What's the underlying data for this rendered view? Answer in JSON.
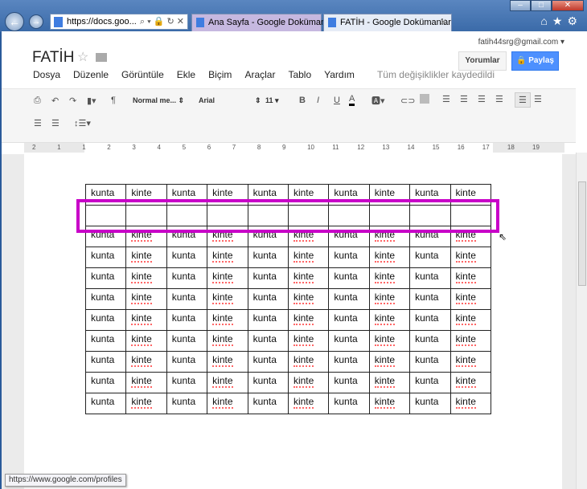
{
  "browser": {
    "address": "https://docs.goo...",
    "tabs": [
      {
        "label": "Ana Sayfa - Google Dokümanlar"
      },
      {
        "label": "FATİH - Google Dokümanlar",
        "active": true
      }
    ],
    "status_url": "https://www.google.com/profiles"
  },
  "header": {
    "title": "FATİH",
    "account": "fatih44srg@gmail.com ▾",
    "comments_label": "Yorumlar",
    "share_label": "Paylaş",
    "share_color": "#4d90fe",
    "save_status": "Tüm değişiklikler kaydedildi"
  },
  "menu": [
    "Dosya",
    "Düzenle",
    "Görüntüle",
    "Ekle",
    "Biçim",
    "Araçlar",
    "Tablo",
    "Yardım"
  ],
  "toolbar": {
    "style": "Normal me...",
    "font": "Arial",
    "size": "11"
  },
  "ruler": [
    "2",
    "1",
    "1",
    "2",
    "3",
    "4",
    "5",
    "6",
    "7",
    "8",
    "9",
    "10",
    "11",
    "12",
    "13",
    "14",
    "15",
    "16",
    "17",
    "18",
    "19"
  ],
  "table": {
    "rows": [
      [
        "kunta",
        "kinte",
        "kunta",
        "kinte",
        "kunta",
        "kinte",
        "kunta",
        "kinte",
        "kunta",
        "kinte"
      ],
      [
        "",
        "",
        "",
        "",
        "",
        "",
        "",
        "",
        "",
        ""
      ],
      [
        "kunta",
        "kinte",
        "kunta",
        "kinte",
        "kunta",
        "kinte",
        "kunta",
        "kinte",
        "kunta",
        "kinte"
      ],
      [
        "kunta",
        "kinte",
        "kunta",
        "kinte",
        "kunta",
        "kinte",
        "kunta",
        "kinte",
        "kunta",
        "kinte"
      ],
      [
        "kunta",
        "kinte",
        "kunta",
        "kinte",
        "kunta",
        "kinte",
        "kunta",
        "kinte",
        "kunta",
        "kinte"
      ],
      [
        "kunta",
        "kinte",
        "kunta",
        "kinte",
        "kunta",
        "kinte",
        "kunta",
        "kinte",
        "kunta",
        "kinte"
      ],
      [
        "kunta",
        "kinte",
        "kunta",
        "kinte",
        "kunta",
        "kinte",
        "kunta",
        "kinte",
        "kunta",
        "kinte"
      ],
      [
        "kunta",
        "kinte",
        "kunta",
        "kinte",
        "kunta",
        "kinte",
        "kunta",
        "kinte",
        "kunta",
        "kinte"
      ],
      [
        "kunta",
        "kinte",
        "kunta",
        "kinte",
        "kunta",
        "kinte",
        "kunta",
        "kinte",
        "kunta",
        "kinte"
      ],
      [
        "kunta",
        "kinte",
        "kunta",
        "kinte",
        "kunta",
        "kinte",
        "kunta",
        "kinte",
        "kunta",
        "kinte"
      ],
      [
        "kunta",
        "kinte",
        "kunta",
        "kinte",
        "kunta",
        "kinte",
        "kunta",
        "kinte",
        "kunta",
        "kinte"
      ]
    ],
    "highlight_color": "#c800c8"
  }
}
